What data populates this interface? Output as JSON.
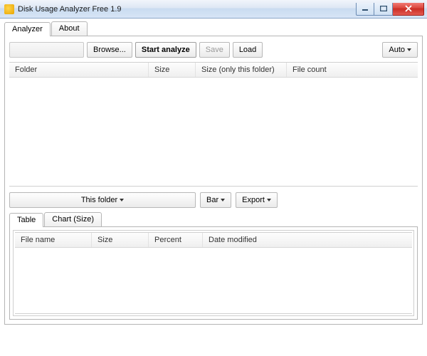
{
  "window": {
    "title": "Disk Usage Analyzer Free 1.9"
  },
  "mainTabs": {
    "analyzer": "Analyzer",
    "about": "About"
  },
  "toolbar": {
    "browse": "Browse...",
    "start": "Start analyze",
    "save": "Save",
    "load": "Load",
    "auto": "Auto"
  },
  "folderList": {
    "cols": {
      "folder": "Folder",
      "size": "Size",
      "sizeThis": "Size (only this folder)",
      "fileCount": "File count"
    }
  },
  "midButtons": {
    "thisFolder": "This folder",
    "bar": "Bar",
    "export": "Export"
  },
  "innerTabs": {
    "table": "Table",
    "chartSize": "Chart (Size)"
  },
  "fileList": {
    "cols": {
      "fileName": "File name",
      "size": "Size",
      "percent": "Percent",
      "dateModified": "Date modified"
    }
  }
}
